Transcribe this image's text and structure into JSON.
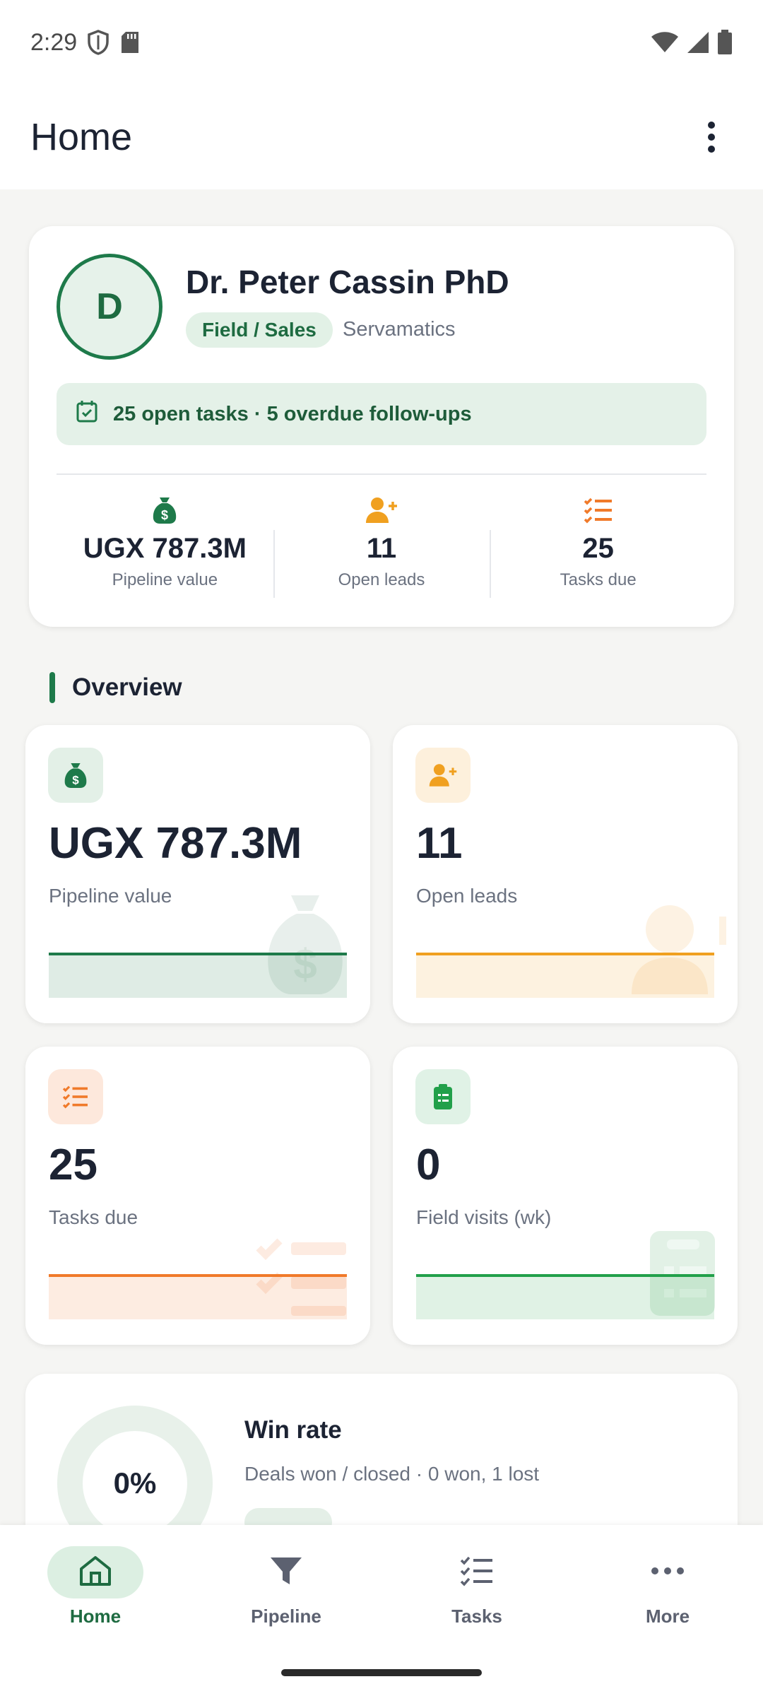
{
  "status_bar": {
    "time": "2:29",
    "icons": [
      "shield-icon",
      "sd-card-icon",
      "wifi-icon",
      "signal-icon",
      "battery-icon"
    ]
  },
  "app_bar": {
    "title": "Home",
    "menu_icon": "more-vertical-icon"
  },
  "profile": {
    "initial": "D",
    "name": "Dr. Peter Cassin PhD",
    "role": "Field / Sales",
    "company": "Servamatics",
    "banner": "25 open tasks · 5 overdue follow-ups",
    "stats": [
      {
        "icon": "money-bag-icon",
        "value": "UGX 787.3M",
        "label": "Pipeline value"
      },
      {
        "icon": "add-person-icon",
        "value": "11",
        "label": "Open leads"
      },
      {
        "icon": "checklist-icon",
        "value": "25",
        "label": "Tasks due"
      }
    ]
  },
  "overview": {
    "title": "Overview",
    "cards": [
      {
        "icon": "money-bag-icon",
        "value": "UGX 787.3M",
        "label": "Pipeline value",
        "accent": "#1e7a4a"
      },
      {
        "icon": "add-person-icon",
        "value": "11",
        "label": "Open leads",
        "accent": "#f0a020"
      },
      {
        "icon": "checklist-icon",
        "value": "25",
        "label": "Tasks due",
        "accent": "#f07a2a"
      },
      {
        "icon": "clipboard-icon",
        "value": "0",
        "label": "Field visits (wk)",
        "accent": "#22a04a"
      }
    ]
  },
  "win_rate": {
    "value": "0%",
    "percent": 0,
    "title": "Win rate",
    "subtitle": "Deals won / closed · 0 won, 1 lost"
  },
  "bottom_nav": {
    "items": [
      {
        "label": "Home",
        "icon": "home-icon",
        "active": true
      },
      {
        "label": "Pipeline",
        "icon": "filter-icon",
        "active": false
      },
      {
        "label": "Tasks",
        "icon": "task-list-icon",
        "active": false
      },
      {
        "label": "More",
        "icon": "more-horizontal-icon",
        "active": false
      }
    ]
  },
  "colors": {
    "primary": "#1e7a4a",
    "orange": "#f0a020",
    "deep_orange": "#f07a2a",
    "green": "#22a04a"
  }
}
